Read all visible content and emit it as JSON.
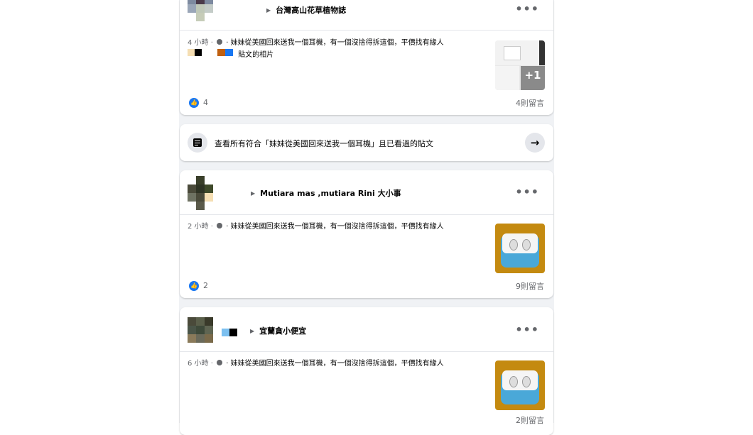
{
  "posts": [
    {
      "group": "台灣高山花草植物誌",
      "time": "4 小時 ·",
      "text": "‧ 妹妹從美國回來送我一個耳機，有一個沒捨得拆這個，平價找有緣人",
      "text2": "貼文的相片",
      "likes": "4",
      "comments": "4則留言",
      "thumb_more": "+1"
    },
    {
      "group": "Mutiara mas ,mutiara Rini 大小事",
      "time": "2 小時 ·",
      "text": "‧ 妹妹從美國回來送我一個耳機，有一個沒捨得拆這個，平價找有緣人",
      "likes": "2",
      "comments": "9則留言"
    },
    {
      "group": "宜蘭貪小便宜",
      "time": "6 小時 ·",
      "text": "‧ 妹妹從美國回來送我一個耳機，有一個沒捨得拆這個，平價找有緣人",
      "comments": "2則留言"
    }
  ],
  "see_all": {
    "text": "查看所有符合「妹妹從美國回來送我一個耳機」且已看過的貼文"
  },
  "icons": {
    "more": "more-options-icon",
    "like": "like-icon",
    "arrow": "arrow-right-icon",
    "post": "post-list-icon",
    "privacy": "globe-icon"
  },
  "colors": {
    "accent": "#1877f2",
    "secondary_text": "#65676b",
    "feed_background": "#f0f2f5"
  }
}
